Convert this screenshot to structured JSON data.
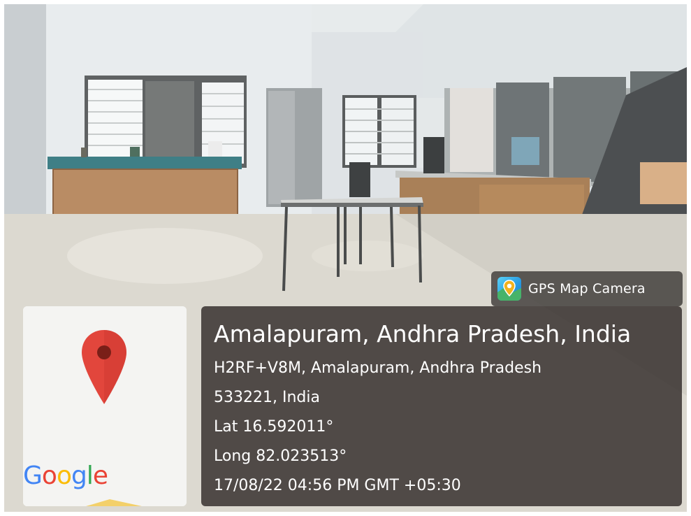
{
  "photo": {
    "description_colors": {
      "floor": "#d9d6cd",
      "wall": "#e9edef",
      "counter": "#b98c64",
      "counter_top": "#3f7f86"
    }
  },
  "badge": {
    "icon": "map-pin-icon",
    "label": "GPS Map Camera"
  },
  "map": {
    "pin_icon": "map-pin-icon",
    "pin_color": "#e2463c",
    "logo_letters": [
      "G",
      "o",
      "o",
      "g",
      "l",
      "e"
    ],
    "logo_colors": [
      "#4285f4",
      "#ea4335",
      "#fbbc05",
      "#4285f4",
      "#34a853",
      "#ea4335"
    ]
  },
  "info": {
    "title": "Amalapuram, Andhra Pradesh, India",
    "address_line1": "H2RF+V8M, Amalapuram, Andhra Pradesh",
    "address_line2": "533221, India",
    "lat": "Lat 16.592011°",
    "long": "Long 82.023513°",
    "datetime": "17/08/22 04:56 PM GMT +05:30"
  }
}
